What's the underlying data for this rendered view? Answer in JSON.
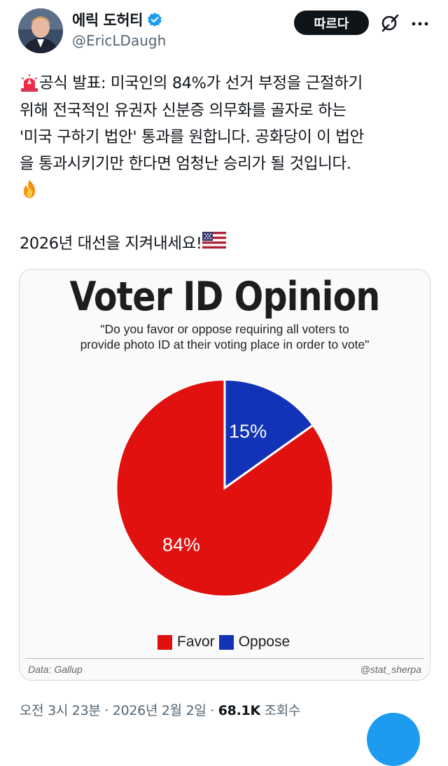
{
  "author": {
    "display_name": "에릭 도허티",
    "handle": "@EricLDaugh",
    "verified_color": "#1d9bf0"
  },
  "actions": {
    "follow_label": "따르다",
    "grok_icon": "grok-icon",
    "more_icon": "more-icon"
  },
  "tweet": {
    "lines": [
      "공식 발표: 미국인의 84%가 선거 부정을 근절하기",
      "위해 전국적인 유권자 신분증 의무화를 골자로 하는",
      "'미국 구하기 법안' 통과를 원합니다. 공화당이 이 법안",
      "을 통과시키기만 한다면 엄청난 승리가 될 것입니다."
    ],
    "second_paragraph": "2026년 대선을 지켜내세요!",
    "emoji": [
      "siren-emoji",
      "fire-emoji",
      "us-flag-emoji"
    ]
  },
  "chart_data": {
    "type": "pie",
    "title": "Voter ID Opinion",
    "subtitle_lines": [
      "\"Do you favor or oppose requiring all voters to",
      "provide photo ID at their voting place in order to vote\""
    ],
    "slices": [
      {
        "name": "Favor",
        "value": 84,
        "label": "84%",
        "color": "#e0110f"
      },
      {
        "name": "Oppose",
        "value": 15,
        "label": "15%",
        "color": "#1233b8"
      }
    ],
    "legend_placement": "bottom",
    "source": "Data: Gallup",
    "credit": "@stat_sherpa"
  },
  "meta": {
    "time": "오전 3시 23분",
    "separator": " · ",
    "date": "2026년 2월 2일",
    "views_count": "68.1K",
    "views_label": " 조회수"
  }
}
